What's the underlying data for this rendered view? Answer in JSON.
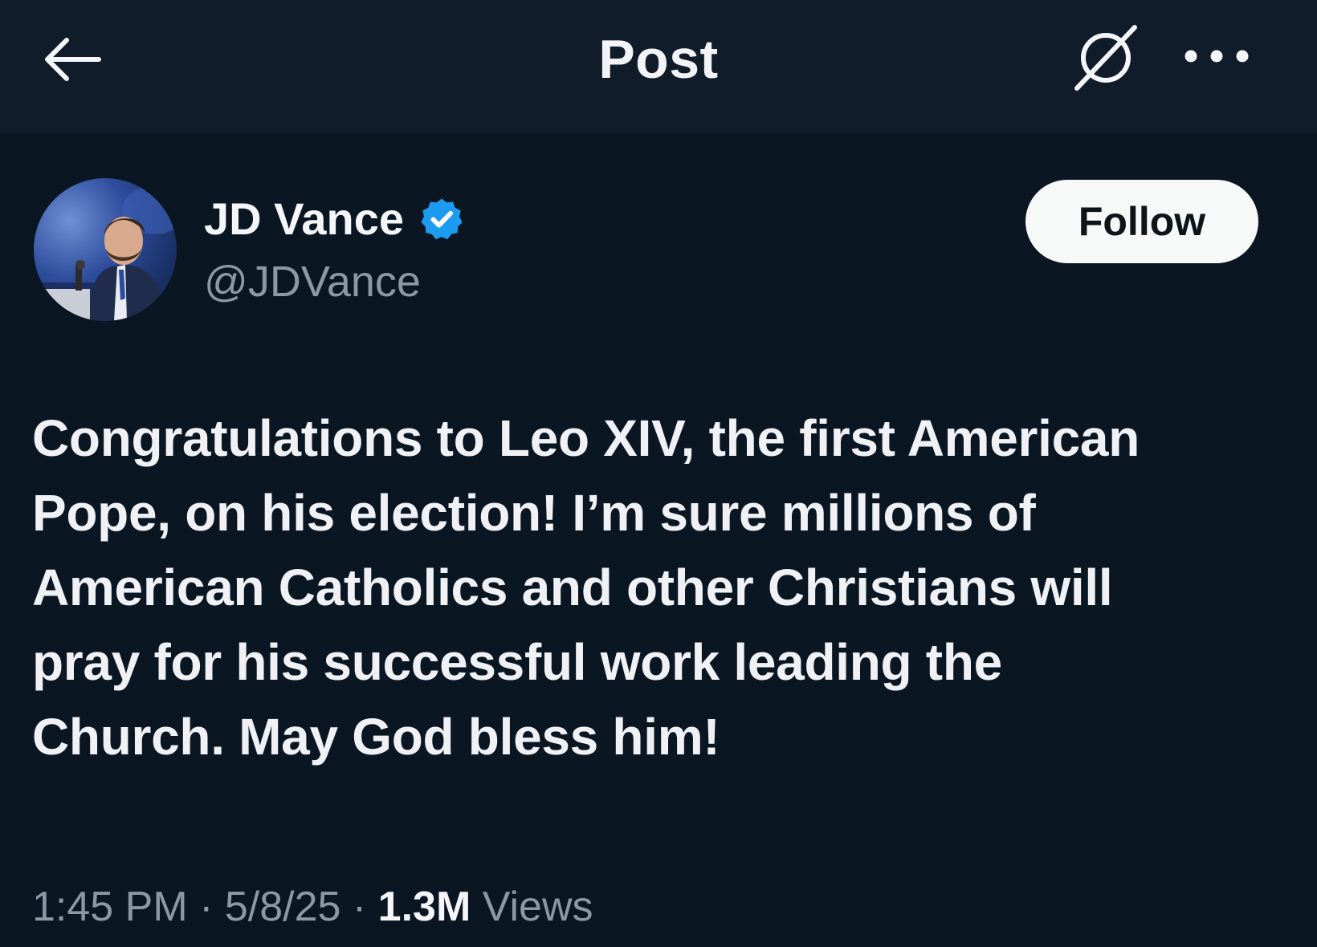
{
  "header": {
    "title": "Post",
    "back_icon": "arrow-left-icon",
    "grok_icon": "grok-icon",
    "more_icon": "more-horizontal-icon"
  },
  "author": {
    "name": "JD Vance",
    "handle": "@JDVance",
    "verified": true,
    "verified_color": "#1d9bf0"
  },
  "follow_label": "Follow",
  "post": {
    "lines": [
      "Congratulations to Leo XIV, the first American",
      "Pope, on his election! I’m sure millions of",
      "American Catholics and other Christians will",
      "pray for his successful work leading the",
      "Church. May God bless him!"
    ]
  },
  "meta": {
    "time": "1:45 PM",
    "separator": " · ",
    "date": "5/8/25",
    "views_count": "1.3M",
    "views_label": " Views"
  },
  "colors": {
    "background": "#0b1623",
    "header_background": "#101c2a",
    "text": "#eff1f5",
    "secondary_text": "#8b98a5",
    "button_bg": "#f7f9f9"
  }
}
